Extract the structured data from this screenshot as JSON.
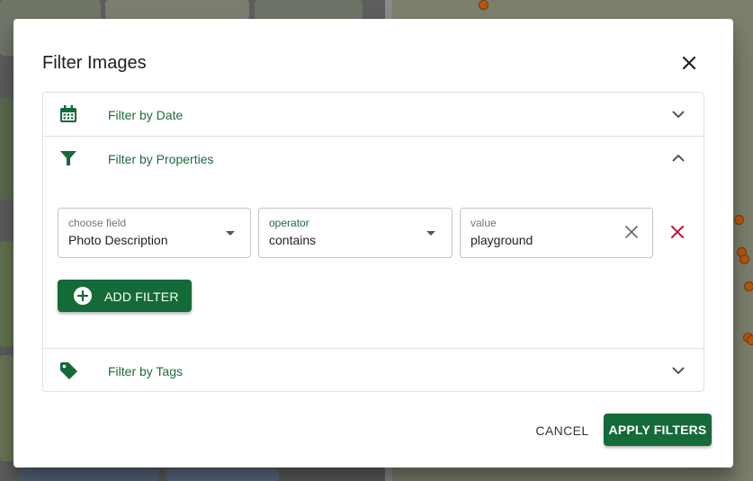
{
  "dialog": {
    "title": "Filter Images",
    "close_icon": "close-icon"
  },
  "sections": [
    {
      "label": "Filter by Date",
      "icon": "calendar-icon",
      "expanded": false
    },
    {
      "label": "Filter by Properties",
      "icon": "funnel-icon",
      "expanded": true
    },
    {
      "label": "Filter by Tags",
      "icon": "tag-icon",
      "expanded": false
    }
  ],
  "property_filter": {
    "field": {
      "label": "choose field",
      "value": "Photo Description"
    },
    "operator": {
      "label": "operator",
      "value": "contains"
    },
    "value": {
      "label": "value",
      "value": "playground"
    }
  },
  "add_filter_label": "ADD FILTER",
  "actions": {
    "cancel": "CANCEL",
    "apply": "APPLY FILTERS"
  },
  "colors": {
    "accent": "#146b38",
    "accent_text": "#1e6b3a",
    "remove": "#c0123c",
    "map_marker": "#b8560e"
  }
}
